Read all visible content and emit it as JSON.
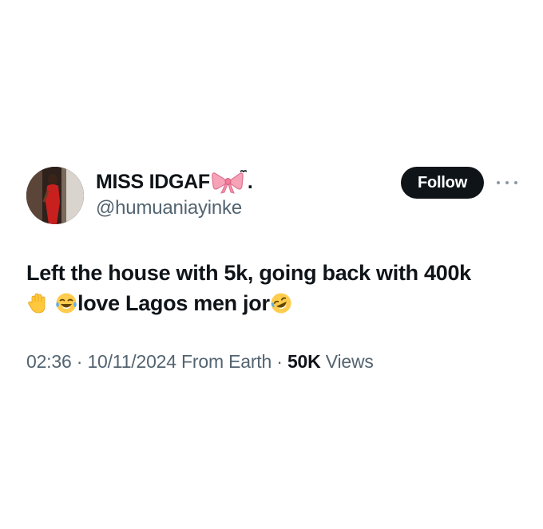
{
  "user": {
    "display_name": "MISS IDGAF",
    "display_name_suffix": ".",
    "handle": "@humuaniayinke",
    "avatar_icon": "avatar-photo",
    "bow_icon": "ribbon-bow-emoji"
  },
  "actions": {
    "follow_label": "Follow",
    "more_icon": "more-dots-icon"
  },
  "tweet": {
    "line1": "Left the house with 5k, going back with 400k",
    "line2_text": "love Lagos men jor",
    "emojis": [
      "raised-hand-emoji",
      "tears-of-joy-emoji",
      "rolling-on-floor-laughing-emoji"
    ]
  },
  "meta": {
    "time": "02:36",
    "separator": "·",
    "date": "10/11/2024",
    "source": "From Earth",
    "views_count": "50K",
    "views_label": "Views"
  },
  "colors": {
    "text_primary": "#0f1419",
    "text_secondary": "#536471",
    "follow_bg": "#0f1419",
    "follow_text": "#ffffff"
  }
}
